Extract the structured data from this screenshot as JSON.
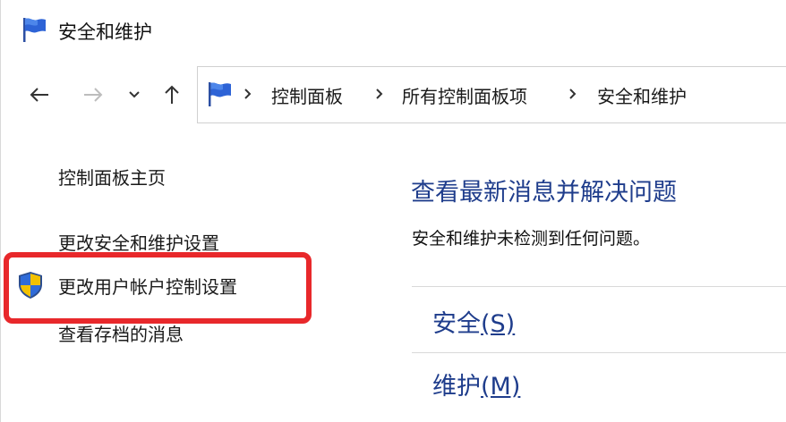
{
  "window": {
    "title": "安全和维护",
    "icon": "security-flag-icon"
  },
  "nav": {
    "back_icon": "back-arrow-icon",
    "forward_icon": "forward-arrow-icon",
    "recent_icon": "chevron-down-icon",
    "up_icon": "up-arrow-icon"
  },
  "address_bar": {
    "icon": "security-flag-icon",
    "breadcrumbs": [
      "控制面板",
      "所有控制面板项",
      "安全和维护"
    ]
  },
  "left_pane": {
    "home_link": "控制面板主页",
    "links": [
      "更改安全和维护设置",
      "更改用户帐户控制设置",
      "查看存档的消息"
    ],
    "uac_icon": "uac-shield-icon",
    "highlight_color": "#e8282b"
  },
  "main": {
    "heading": "查看最新消息并解决问题",
    "description": "安全和维护未检测到任何问题。",
    "sections": [
      {
        "label": "安全",
        "hotkey": "(S)"
      },
      {
        "label": "维护",
        "hotkey": "(M)"
      }
    ],
    "accent_color": "#1f3d8c"
  }
}
